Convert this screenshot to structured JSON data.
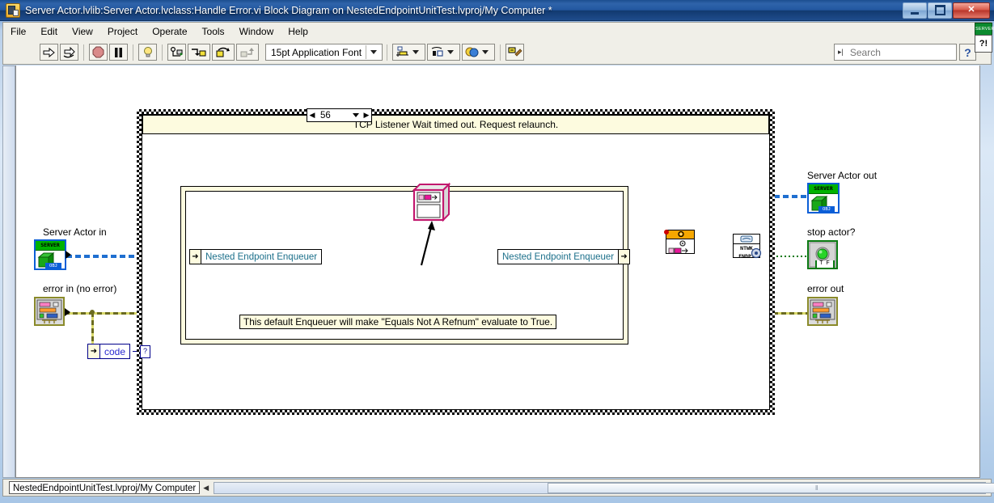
{
  "window": {
    "title": "Server Actor.lvlib:Server Actor.lvclass:Handle Error.vi Block Diagram on NestedEndpointUnitTest.lvproj/My Computer *",
    "app_icon": "labview-vi-icon",
    "minimize_label": "–",
    "maximize_label": "□",
    "close_label": "✕"
  },
  "menu": {
    "items": [
      {
        "label": "File"
      },
      {
        "label": "Edit"
      },
      {
        "label": "View"
      },
      {
        "label": "Project"
      },
      {
        "label": "Operate"
      },
      {
        "label": "Tools"
      },
      {
        "label": "Window"
      },
      {
        "label": "Help"
      }
    ]
  },
  "toolbar": {
    "run_icon": "run-arrow-icon",
    "run_continuous_icon": "run-continuously-icon",
    "abort_icon": "abort-stop-icon",
    "pause_icon": "pause-icon",
    "highlight_icon": "highlight-execution-bulb-icon",
    "retain_wire_icon": "retain-wire-values-icon",
    "step_into_icon": "step-into-icon",
    "step_over_icon": "step-over-icon",
    "step_out_icon": "step-out-icon",
    "font_label": "15pt Application Font",
    "align_icon": "align-objects-icon",
    "distribute_icon": "distribute-objects-icon",
    "reorder_icon": "reorder-icon",
    "cleanup_icon": "clean-up-diagram-icon",
    "help_label": "?",
    "badge_label": "SERVER",
    "context_help_label": "?!"
  },
  "search": {
    "placeholder": "Search",
    "value": "",
    "icon": "magnifier-icon",
    "expander_icon": "expand-left-icon"
  },
  "diagram": {
    "case_structure": {
      "selector_value": "56",
      "selector_left_icon": "left-arrow-icon",
      "selector_right_icon": "right-arrow-icon",
      "selector_dropdown_icon": "chevron-down-icon",
      "subdiagram_label": "TCP Listener Wait timed out. Request relaunch."
    },
    "terminals": {
      "server_actor_in": {
        "label": "Server Actor in",
        "badge": "SERVER",
        "type_tag": "OBJ",
        "icon": "lv-object-cube-icon"
      },
      "error_in": {
        "label": "error in (no error)",
        "icon": "error-cluster-icon"
      },
      "server_actor_out": {
        "label": "Server Actor out",
        "badge": "SERVER",
        "type_tag": "OBJ",
        "icon": "lv-object-cube-icon"
      },
      "stop_actor": {
        "label": "stop actor?",
        "tf_label": "T F",
        "icon": "boolean-led-icon"
      },
      "error_out": {
        "label": "error out",
        "icon": "error-cluster-icon"
      }
    },
    "nodes": {
      "enqueuer_in_label": "Nested Endpoint Enqueuer",
      "enqueuer_out_label": "Nested Endpoint Enqueuer",
      "code_constant": "code",
      "unbundle_icon": "unbundle-by-name-icon",
      "invoke_node_icon": "invoke-node-3d-icon",
      "property_node_icon": "property-node-gear-icon",
      "endpoint_node_line1": "NTWK",
      "endpoint_node_line2": "ENDPT",
      "endpoint_node_icon": "network-endpoint-icon",
      "question_tunnel": "?"
    },
    "comment": "This default Enqueuer will make \"Equals Not A Refnum\" evaluate to True."
  },
  "status": {
    "path": "NestedEndpointUnitTest.lvproj/My Computer",
    "collapse_icon": "left-arrow-icon",
    "scrollbar_grip": "‖"
  }
}
